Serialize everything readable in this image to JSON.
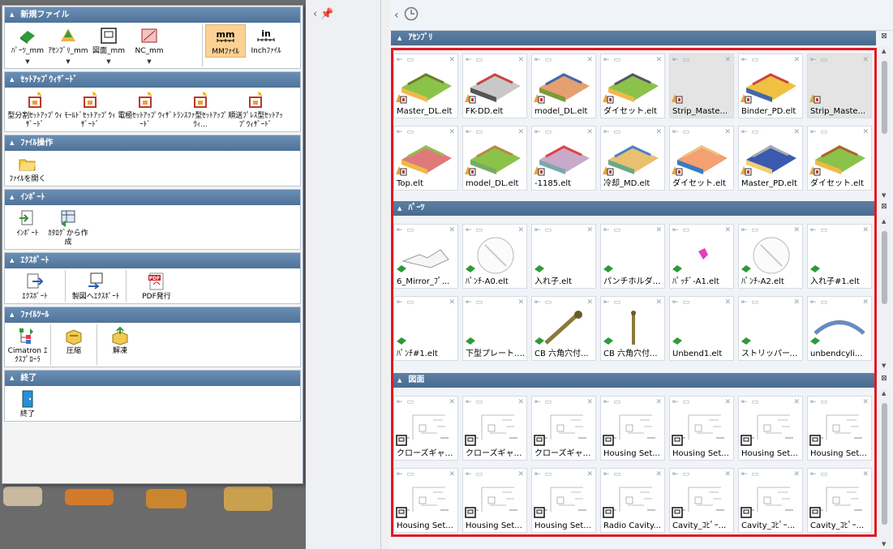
{
  "menu": {
    "sections": [
      {
        "title": "新規ファイル",
        "tools": [
          {
            "label": "ﾊﾟｰﾂ_mm",
            "icon": "part-icon",
            "dropdown": true
          },
          {
            "label": "ｱｾﾝﾌﾞﾘ_mm",
            "icon": "assembly-icon",
            "dropdown": true
          },
          {
            "label": "図面_mm",
            "icon": "drawing-icon",
            "dropdown": true
          },
          {
            "label": "NC_mm",
            "icon": "nc-icon",
            "dropdown": true
          },
          {
            "label": "MMﾌｧｲﾙ",
            "icon": "mm-unit-icon",
            "glyph": "mm",
            "highlighted": true
          },
          {
            "label": "Inchﾌｧｲﾙ",
            "icon": "inch-unit-icon",
            "glyph": "in"
          }
        ]
      },
      {
        "title": "ｾｯﾄｱｯﾌﾟｳｨｻﾞｰﾄﾞ",
        "tools": [
          {
            "label": "型分割ｾｯﾄｱｯﾌﾟｳｨｻﾞｰﾄﾞ",
            "icon": "mold-split-wizard-icon"
          },
          {
            "label": "ﾓｰﾙﾄﾞｾｯﾄｱｯﾌﾟｳｨｻﾞｰﾄﾞ",
            "icon": "mold-setup-wizard-icon"
          },
          {
            "label": "電極ｾｯﾄｱｯﾌﾟｳｨｻﾞｰﾄﾞ",
            "icon": "electrode-wizard-icon"
          },
          {
            "label": "ﾄﾗﾝｽﾌｧ型ｾｯﾄｱｯﾌﾟｳｨ...",
            "icon": "transfer-wizard-icon"
          },
          {
            "label": "順送ﾌﾟﾚｽ型ｾｯﾄｱｯﾌﾟｳｨｻﾞｰﾄﾞ",
            "icon": "progressive-wizard-icon"
          }
        ]
      },
      {
        "title": "ﾌｧｲﾙ操作",
        "tools": [
          {
            "label": "ﾌｧｲﾙを開く",
            "icon": "open-folder-icon"
          }
        ]
      },
      {
        "title": "ｲﾝﾎﾟｰﾄ",
        "tools": [
          {
            "label": "ｲﾝﾎﾟｰﾄ",
            "icon": "import-icon"
          },
          {
            "label": "ｶﾀﾛｸﾞから作成",
            "icon": "catalog-icon"
          }
        ]
      },
      {
        "title": "ｴｸｽﾎﾟｰﾄ",
        "tools": [
          {
            "label": "ｴｸｽﾎﾟｰﾄ",
            "icon": "export-icon"
          },
          {
            "label": "製図へｴｸｽﾎﾟｰﾄ",
            "icon": "export-drawing-icon"
          },
          {
            "label": "PDF発行",
            "icon": "pdf-icon",
            "glyph": "PDF"
          }
        ]
      },
      {
        "title": "ﾌｧｲﾙﾂｰﾙ",
        "tools": [
          {
            "label": "Cimatron ｴｸｽﾌﾟﾛｰﾗ",
            "icon": "explorer-icon"
          },
          {
            "label": "圧縮",
            "icon": "compress-icon"
          },
          {
            "label": "解凍",
            "icon": "extract-icon"
          }
        ]
      },
      {
        "title": "終了",
        "tools": [
          {
            "label": "終了",
            "icon": "exit-door-icon"
          }
        ]
      }
    ]
  },
  "panels": [
    {
      "title": "ｱｾﾝﾌﾞﾘ",
      "type": "assembly",
      "items": [
        "Master_DL.elt",
        "FK-DD.elt",
        "model_DL.elt",
        "ダイセット.elt",
        "Strip_Maste...",
        "Binder_PD.elt",
        "Strip_Maste...",
        "Top.elt",
        "model_DL.elt",
        "-1185.elt",
        "冷却_MD.elt",
        "ダイセット.elt",
        "Master_PD.elt",
        "ダイセット.elt"
      ]
    },
    {
      "title": "ﾊﾟｰﾂ",
      "type": "part",
      "items": [
        "6_Mirror_ﾌﾟ...",
        "ﾊﾟﾝﾁ-A0.elt",
        "入れ子.elt",
        "パンチホルダー...",
        "ﾊﾟｯﾁﾞ-A1.elt",
        "ﾊﾟﾝﾁ-A2.elt",
        "入れ子#1.elt",
        "ﾊﾟﾝﾁ#1.elt",
        "下型プレート.elt",
        "CB 六角穴付...",
        "CB 六角穴付...",
        "Unbend1.elt",
        "ストリッパープレ...",
        "unbendcyli..."
      ]
    },
    {
      "title": "図面",
      "type": "drawing",
      "items": [
        "クローズギャッ...",
        "クローズギャッ...",
        "クローズギャッ...",
        "Housing Set...",
        "Housing Set...",
        "Housing Set...",
        "Housing Set...",
        "Housing Set...",
        "Housing Set...",
        "Housing Set...",
        "Radio Cavity...",
        "Cavity_ｺﾋﾟｰ...",
        "Cavity_ｺﾋﾟｰ...",
        "Cavity_ｺﾋﾟｰ..."
      ]
    }
  ],
  "card_controls": {
    "pin": "⇤",
    "folder": "▭",
    "close": "✕"
  },
  "colors": {
    "header_blue": "#5e7fa3",
    "highlight": "#fcd194",
    "red_frame": "#e01a22"
  }
}
